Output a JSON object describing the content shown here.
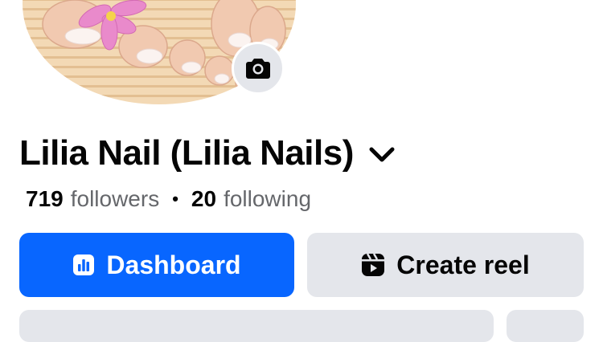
{
  "profile": {
    "name": "Lilia Nail (Lilia Nails)",
    "avatar_icon": "profile-photo",
    "camera_icon": "camera-icon"
  },
  "stats": {
    "followers_count": "719",
    "followers_label": "followers",
    "separator": "•",
    "following_count": "20",
    "following_label": "following"
  },
  "actions": {
    "dashboard_label": "Dashboard",
    "create_reel_label": "Create reel"
  },
  "colors": {
    "primary": "#0866ff",
    "secondary_bg": "#e4e6eb",
    "muted_text": "#65676b"
  }
}
